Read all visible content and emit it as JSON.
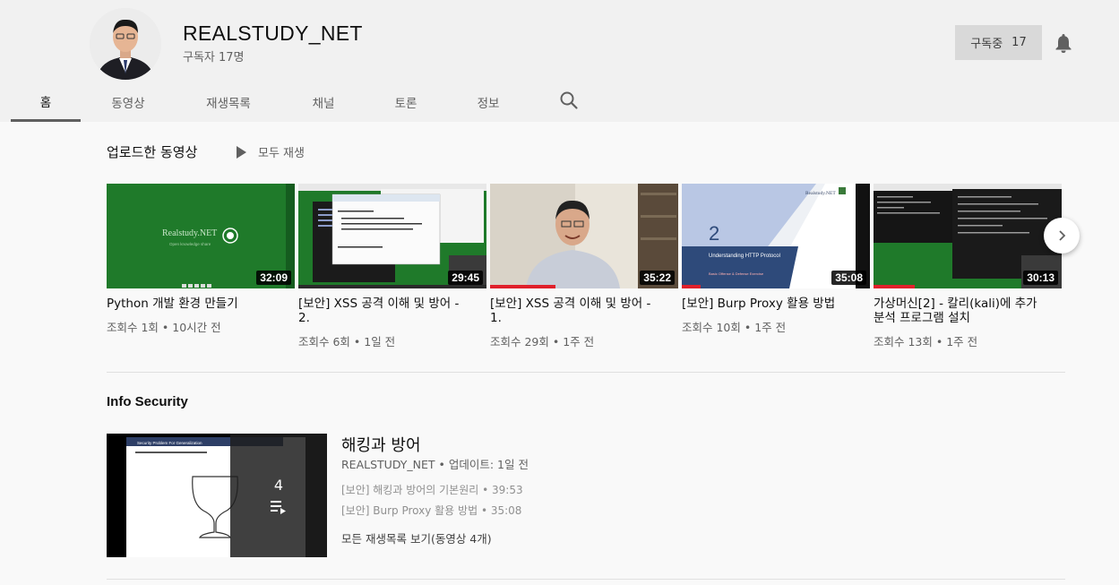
{
  "channel": {
    "name": "REALSTUDY_NET",
    "subscribers": "구독자 17명",
    "subscribe_label": "구독중",
    "subscribe_count": "17"
  },
  "tabs": [
    {
      "label": "홈",
      "active": true
    },
    {
      "label": "동영상",
      "active": false
    },
    {
      "label": "재생목록",
      "active": false
    },
    {
      "label": "채널",
      "active": false
    },
    {
      "label": "토론",
      "active": false
    },
    {
      "label": "정보",
      "active": false
    }
  ],
  "uploads": {
    "title": "업로드한 동영상",
    "play_all": "모두 재생",
    "videos": [
      {
        "title": "Python 개발 환경 만들기",
        "meta": "조회수 1회 • 10시간 전",
        "duration": "32:09",
        "progress": 0
      },
      {
        "title": "[보안] XSS 공격 이해 및 방어 - 2.",
        "meta": "조회수 6회 • 1일 전",
        "duration": "29:45",
        "progress": 0
      },
      {
        "title": "[보안] XSS 공격 이해 및 방어 - 1.",
        "meta": "조회수 29회 • 1주 전",
        "duration": "35:22",
        "progress": 0.35
      },
      {
        "title": "[보안] Burp Proxy 활용 방법",
        "meta": "조회수 10회 • 1주 전",
        "duration": "35:08",
        "progress": 0.1
      },
      {
        "title": "가상머신[2] - 칼리(kali)에 추가 분석 프로그램 설치",
        "meta": "조회수 13회 • 1주 전",
        "duration": "30:13",
        "progress": 0.22
      }
    ]
  },
  "thumb_text": {
    "realstudy_logo": "Realstudy.NET",
    "realstudy_sub": "Open knowledge share",
    "http_number": "2",
    "http_title": "Understanding HTTP Protocol",
    "http_sub": "Basic Offense & Defense Exercise",
    "playlist_slide_title": "Security Problem For Generalization"
  },
  "playlist_section": {
    "title": "Info Security",
    "playlist": {
      "title": "해킹과 방어",
      "owner": "REALSTUDY_NET",
      "updated": "업데이트: 1일 전",
      "count": "4",
      "items": [
        {
          "title": "[보안] 해킹과 방어의 기본원리",
          "duration": "39:53"
        },
        {
          "title": "[보안] Burp Proxy 활용 방법",
          "duration": "35:08"
        }
      ],
      "view_all": "모든 재생목록 보기(동영상 4개)"
    }
  },
  "colors": {
    "accent_red": "#e0202b",
    "green_bg": "#1f7a2a"
  }
}
